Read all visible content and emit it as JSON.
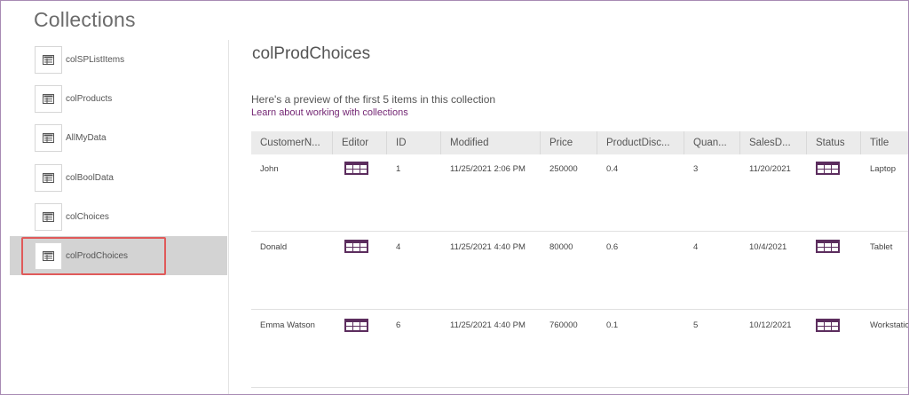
{
  "page": {
    "title": "Collections"
  },
  "sidebar": {
    "items": [
      {
        "label": "colSPListItems",
        "active": false
      },
      {
        "label": "colProducts",
        "active": false
      },
      {
        "label": "AllMyData",
        "active": false
      },
      {
        "label": "colBoolData",
        "active": false
      },
      {
        "label": "colChoices",
        "active": false
      },
      {
        "label": "colProdChoices",
        "active": true
      }
    ]
  },
  "main": {
    "collection_name": "colProdChoices",
    "preview_text": "Here's a preview of the first 5 items in this collection",
    "learn_link": "Learn about working with collections",
    "columns": [
      "CustomerN...",
      "Editor",
      "ID",
      "Modified",
      "Price",
      "ProductDisc...",
      "Quan...",
      "SalesD...",
      "Status",
      "Title"
    ],
    "rows": [
      {
        "CustomerName": "John",
        "ID": "1",
        "Modified": "11/25/2021 2:06 PM",
        "Price": "250000",
        "ProductDiscount": "0.4",
        "Quantity": "3",
        "SalesDate": "11/20/2021",
        "Title": "Laptop"
      },
      {
        "CustomerName": "Donald",
        "ID": "4",
        "Modified": "11/25/2021 4:40 PM",
        "Price": "80000",
        "ProductDiscount": "0.6",
        "Quantity": "4",
        "SalesDate": "10/4/2021",
        "Title": "Tablet"
      },
      {
        "CustomerName": "Emma Watson",
        "ID": "6",
        "Modified": "11/25/2021 4:40 PM",
        "Price": "760000",
        "ProductDiscount": "0.1",
        "Quantity": "5",
        "SalesDate": "10/12/2021",
        "Title": "Workstatio"
      }
    ]
  },
  "colors": {
    "accent": "#742774",
    "record_icon": "#5c2d5e",
    "highlight": "#e05a5a",
    "active_bg": "#d3d3d3"
  },
  "icons": {
    "collection": "table-card-icon",
    "record": "table-record-icon"
  }
}
